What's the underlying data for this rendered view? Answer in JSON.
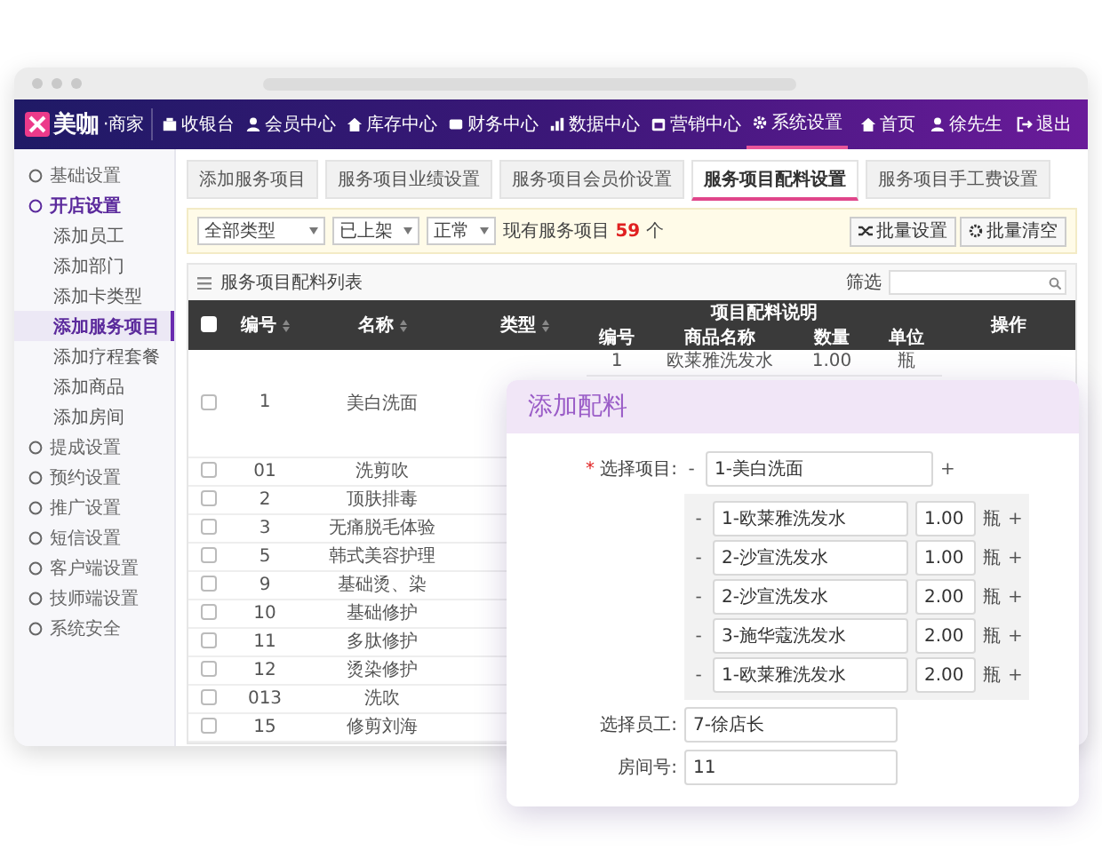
{
  "logo": {
    "name": "美咖",
    "suffix": "·商家"
  },
  "nav": {
    "items": [
      {
        "label": "收银台",
        "selected": false
      },
      {
        "label": "会员中心",
        "selected": false
      },
      {
        "label": "库存中心",
        "selected": false
      },
      {
        "label": "财务中心",
        "selected": false
      },
      {
        "label": "数据中心",
        "selected": false
      },
      {
        "label": "营销中心",
        "selected": false
      },
      {
        "label": "系统设置",
        "selected": true
      }
    ],
    "user_items": [
      "首页",
      "徐先生",
      "退出"
    ]
  },
  "sidebar": {
    "items": [
      {
        "label": "基础设置",
        "expanded": false,
        "selected": false
      },
      {
        "label": "开店设置",
        "expanded": true,
        "selected": false,
        "children": [
          {
            "label": "添加员工",
            "selected": false
          },
          {
            "label": "添加部门",
            "selected": false
          },
          {
            "label": "添加卡类型",
            "selected": false
          },
          {
            "label": "添加服务项目",
            "selected": true
          },
          {
            "label": "添加疗程套餐",
            "selected": false
          },
          {
            "label": "添加商品",
            "selected": false
          },
          {
            "label": "添加房间",
            "selected": false
          }
        ]
      },
      {
        "label": "提成设置",
        "expanded": false,
        "selected": false
      },
      {
        "label": "预约设置",
        "expanded": false,
        "selected": false
      },
      {
        "label": "推广设置",
        "expanded": false,
        "selected": false
      },
      {
        "label": "短信设置",
        "expanded": false,
        "selected": false
      },
      {
        "label": "客户端设置",
        "expanded": false,
        "selected": false
      },
      {
        "label": "技师端设置",
        "expanded": false,
        "selected": false
      },
      {
        "label": "系统安全",
        "expanded": false,
        "selected": false
      }
    ]
  },
  "tabs": [
    {
      "label": "添加服务项目",
      "selected": false
    },
    {
      "label": "服务项目业绩设置",
      "selected": false
    },
    {
      "label": "服务项目会员价设置",
      "selected": false
    },
    {
      "label": "服务项目配料设置",
      "selected": true
    },
    {
      "label": "服务项目手工费设置",
      "selected": false
    }
  ],
  "filter": {
    "selects": [
      "全部类型",
      "已上架",
      "正常"
    ],
    "summary": "现有服务项目 **59** 个",
    "buttons": [
      "批量设置",
      "批量清空"
    ]
  },
  "table": {
    "title": "服务项目配料列表",
    "search_label": "筛选",
    "header_checked": false,
    "columns": [
      "编号",
      "名称",
      "类型"
    ],
    "group": "项目配料说明",
    "sub_columns": [
      "编号",
      "商品名称",
      "数量",
      "单位"
    ],
    "action": "操作",
    "rows": [
      {
        "no": "1",
        "name": "美白洗面",
        "checked": false,
        "ingredients": [
          {
            "no": "1",
            "name": "欧莱雅洗发水",
            "quantity": "1.00",
            "unit": "瓶"
          }
        ]
      },
      {
        "no": "01",
        "name": "洗剪吹",
        "checked": false
      },
      {
        "no": "2",
        "name": "顶肤排毒",
        "checked": false
      },
      {
        "no": "3",
        "name": "无痛脱毛体验",
        "checked": false
      },
      {
        "no": "5",
        "name": "韩式美容护理",
        "checked": false
      },
      {
        "no": "9",
        "name": "基础烫、染",
        "checked": false
      },
      {
        "no": "10",
        "name": "基础修护",
        "checked": false
      },
      {
        "no": "11",
        "name": "多肽修护",
        "checked": false
      },
      {
        "no": "12",
        "name": "烫染修护",
        "checked": false
      },
      {
        "no": "013",
        "name": "洗吹",
        "checked": false
      },
      {
        "no": "15",
        "name": "修剪刘海",
        "checked": false
      }
    ]
  },
  "dialog": {
    "title": "添加配料",
    "project": {
      "required_mark": "*",
      "label": "选择项目:",
      "remove": "-",
      "value": "1-美白洗面",
      "add": "+"
    },
    "ingredients": [
      {
        "remove": "-",
        "name": "1-欧莱雅洗发水",
        "quantity": "1.00",
        "unit": "瓶",
        "add": "+"
      },
      {
        "remove": "-",
        "name": "2-沙宣洗发水",
        "quantity": "1.00",
        "unit": "瓶",
        "add": "+"
      },
      {
        "remove": "-",
        "name": "2-沙宣洗发水",
        "quantity": "2.00",
        "unit": "瓶",
        "add": "+"
      },
      {
        "remove": "-",
        "name": "3-施华蔻洗发水",
        "quantity": "2.00",
        "unit": "瓶",
        "add": "+"
      },
      {
        "remove": "-",
        "name": "1-欧莱雅洗发水",
        "quantity": "2.00",
        "unit": "瓶",
        "add": "+"
      }
    ],
    "fields": [
      {
        "label": "选择员工:",
        "value": "7-徐店长"
      },
      {
        "label": "房间号:",
        "value": "11"
      }
    ]
  }
}
